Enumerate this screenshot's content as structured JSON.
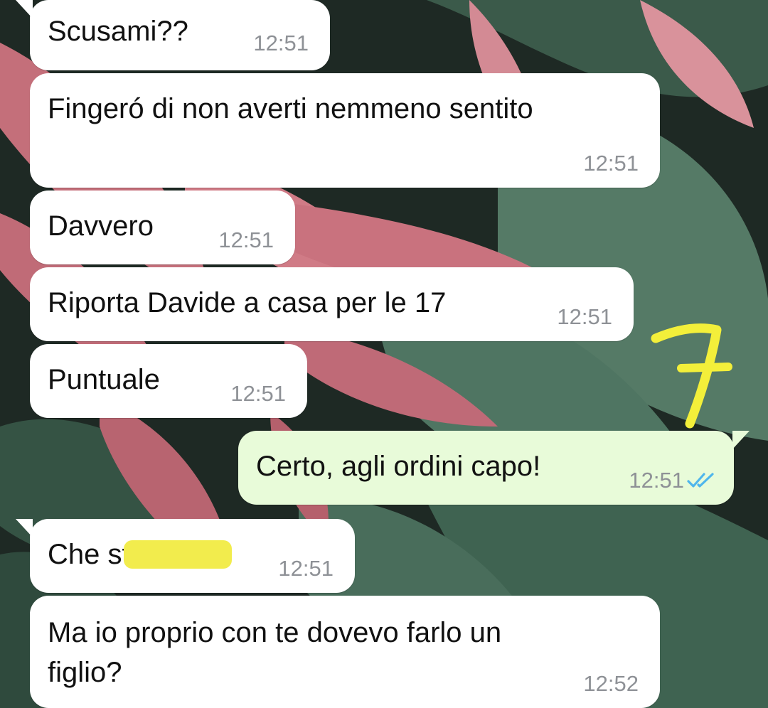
{
  "messages": [
    {
      "text": "Scusami??",
      "time": "12:51",
      "direction": "incoming"
    },
    {
      "text": "Fingeró di non averti nemmeno sentito",
      "time": "12:51",
      "direction": "incoming"
    },
    {
      "text": "Davvero",
      "time": "12:51",
      "direction": "incoming"
    },
    {
      "text": "Riporta Davide a casa per le 17",
      "time": "12:51",
      "direction": "incoming"
    },
    {
      "text": "Puntuale",
      "time": "12:51",
      "direction": "incoming"
    },
    {
      "text": "Certo, agli ordini capo!",
      "time": "12:51",
      "direction": "outgoing",
      "status": "read"
    },
    {
      "text": "Che stronzo",
      "time": "12:51",
      "direction": "incoming",
      "redacted": true
    },
    {
      "text": "Ma io proprio con te dovevo farlo un\nfiglio?",
      "time": "12:52",
      "direction": "incoming"
    }
  ],
  "annotation": {
    "handwritten": "7",
    "color": "#f3ef3a"
  },
  "colors": {
    "incoming_bubble": "#ffffff",
    "outgoing_bubble": "#e8fbd9",
    "read_ticks": "#4fb6ec",
    "timestamp": "#8e9196"
  }
}
